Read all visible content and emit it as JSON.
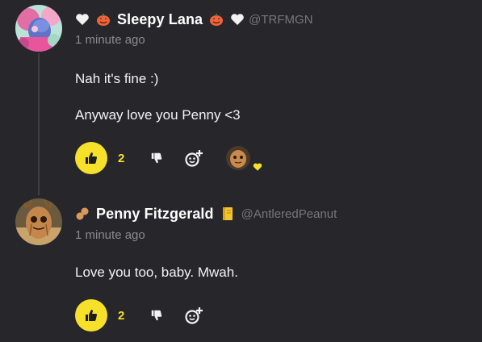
{
  "comments": [
    {
      "username": "Sleepy Lana",
      "handle": "@TRFMGN",
      "timestamp": "1 minute ago",
      "lines": [
        "Nah it's fine :)",
        "Anyway love you Penny <3"
      ],
      "upvotes": "2",
      "name_emojis": [
        "white-heart-icon",
        "jack-o-lantern-icon",
        "jack-o-lantern-icon",
        "white-heart-icon"
      ],
      "reaction": {
        "avatar": "penny-avatar",
        "emoji": "yellow-heart-icon"
      }
    },
    {
      "username": "Penny Fitzgerald",
      "handle": "@AntleredPeanut",
      "timestamp": "1 minute ago",
      "lines": [
        "Love you too, baby. Mwah."
      ],
      "upvotes": "2",
      "name_emojis": [
        "peanut-icon",
        "notebook-icon"
      ]
    }
  ],
  "colors": {
    "background": "#27262b",
    "accent": "#f7e02a",
    "muted": "#8b8a91"
  }
}
